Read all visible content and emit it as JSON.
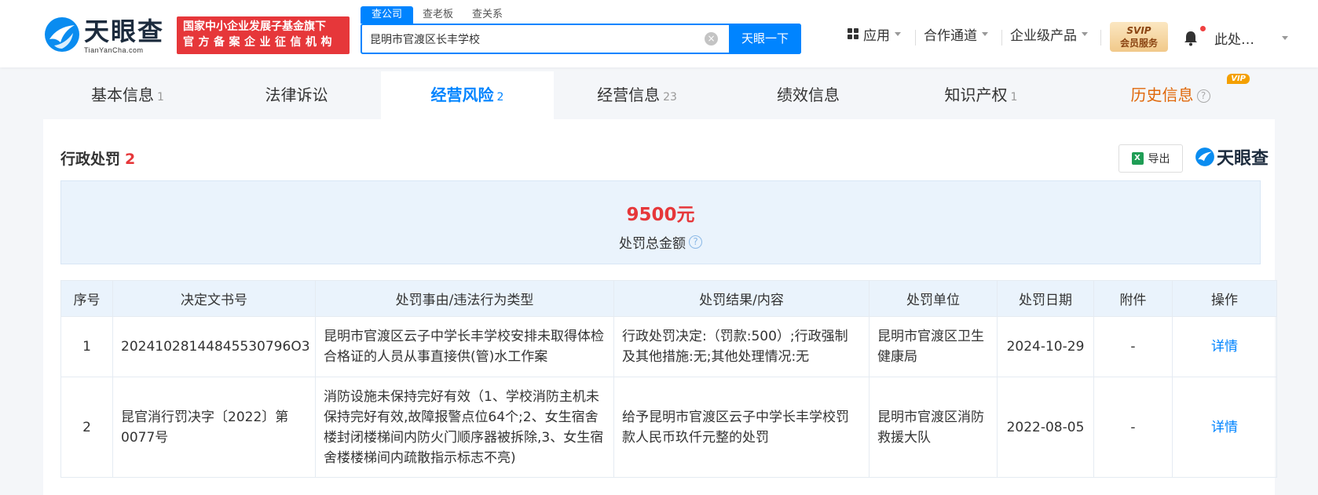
{
  "brand": {
    "name_cn": "天眼查",
    "name_en": "TianYanCha.com",
    "slogan_line1": "国家中小企业发展子基金旗下",
    "slogan_line2": "官方备案企业征信机构"
  },
  "search": {
    "tabs": [
      "查公司",
      "查老板",
      "查关系"
    ],
    "active_tab": "查公司",
    "query": "昆明市官渡区长丰学校",
    "button": "天眼一下"
  },
  "nav": {
    "apps": "应用",
    "partner": "合作通道",
    "enterprise": "企业级产品",
    "vip_line1": "SVIP",
    "vip_line2": "会员服务",
    "user": "此处…"
  },
  "tabs": [
    {
      "label": "基本信息",
      "count": "1"
    },
    {
      "label": "法律诉讼",
      "count": ""
    },
    {
      "label": "经营风险",
      "count": "2"
    },
    {
      "label": "经营信息",
      "count": "23"
    },
    {
      "label": "绩效信息",
      "count": ""
    },
    {
      "label": "知识产权",
      "count": "1"
    },
    {
      "label": "历史信息",
      "count": "",
      "badge": "VIP"
    }
  ],
  "section": {
    "title": "行政处罚",
    "count": "2",
    "export": "导出",
    "brand_mark": "天眼查"
  },
  "summary": {
    "amount": "9500元",
    "label": "处罚总金额"
  },
  "table": {
    "headers": [
      "序号",
      "决定文书号",
      "处罚事由/违法行为类型",
      "处罚结果/内容",
      "处罚单位",
      "处罚日期",
      "附件",
      "操作"
    ],
    "rows": [
      {
        "index": "1",
        "doc_no": "20241028144845530796O3",
        "reason": "昆明市官渡区云子中学长丰学校安排未取得体检合格证的人员从事直接供(管)水工作案",
        "result": "行政处罚决定:（罚款:500）;行政强制及其他措施:无;其他处理情况:无",
        "unit": "昆明市官渡区卫生健康局",
        "date": "2024-10-29",
        "attachment": "-",
        "action": "详情"
      },
      {
        "index": "2",
        "doc_no": "昆官消行罚决字〔2022〕第0077号",
        "reason": "消防设施未保持完好有效（1、学校消防主机未保持完好有效,故障报警点位64个;2、女生宿舍楼封闭楼梯间内防火门顺序器被拆除,3、女生宿舍楼楼梯间内疏散指示标志不亮)",
        "result": "给予昆明市官渡区云子中学长丰学校罚款人民币玖仟元整的处罚",
        "unit": "昆明市官渡区消防救援大队",
        "date": "2022-08-05",
        "attachment": "-",
        "action": "详情"
      }
    ]
  },
  "colors": {
    "accent": "#0084ff",
    "danger": "#e6373a",
    "history": "#e0680a",
    "summary_bg": "#eaf3fc"
  }
}
